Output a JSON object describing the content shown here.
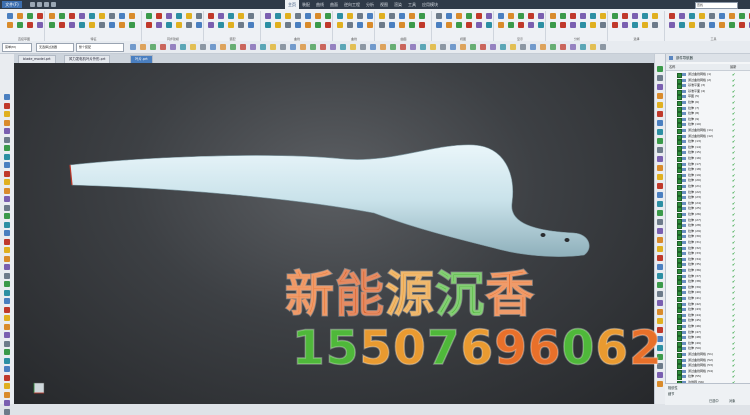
{
  "app": {
    "logo": "文件(F)"
  },
  "menu_tabs": [
    "主页",
    "装配",
    "曲线",
    "曲面",
    "逆向工程",
    "分析",
    "视图",
    "渲染",
    "工具",
    "应用模块"
  ],
  "search": {
    "value": "查找"
  },
  "ribbon_groups": [
    "直接草图",
    "特征",
    "同步建模",
    "装配",
    "曲线",
    "曲线",
    "曲面",
    "视图",
    "显示",
    "分析",
    "选择",
    "工具"
  ],
  "toolbar2": {
    "menu_label": "菜单(M)",
    "selection_filter": "无选择过滤器",
    "scope": "整个装配"
  },
  "doc_tabs": [
    {
      "label": "blade_model.prt",
      "active": false
    },
    {
      "label": "风力发电机叶片外形.prt",
      "active": false
    },
    {
      "label": "叶片.prt",
      "active": true
    }
  ],
  "navigator": {
    "title": "部件导航器",
    "col_name": "名称",
    "col_status": "最新",
    "rows": [
      "通过曲线网格 (1)",
      "通过曲线网格 (2)",
      "基准平面 (3)",
      "基准平面 (4)",
      "草图 (5)",
      "拉伸 (6)",
      "拉伸 (7)",
      "拉伸 (8)",
      "拉伸 (9)",
      "拉伸 (10)",
      "通过曲线网格 (11)",
      "通过曲线网格 (12)",
      "拉伸 (13)",
      "拉伸 (14)",
      "拉伸 (15)",
      "拉伸 (16)",
      "拉伸 (17)",
      "拉伸 (18)",
      "拉伸 (19)",
      "拉伸 (20)",
      "拉伸 (21)",
      "拉伸 (22)",
      "拉伸 (23)",
      "拉伸 (24)",
      "拉伸 (25)",
      "拉伸 (26)",
      "拉伸 (27)",
      "拉伸 (28)",
      "拉伸 (29)",
      "拉伸 (30)",
      "拉伸 (31)",
      "拉伸 (32)",
      "拉伸 (33)",
      "拉伸 (34)",
      "拉伸 (35)",
      "拉伸 (36)",
      "拉伸 (37)",
      "拉伸 (38)",
      "拉伸 (39)",
      "拉伸 (40)",
      "拉伸 (41)",
      "拉伸 (42)",
      "拉伸 (43)",
      "拉伸 (44)",
      "拉伸 (45)",
      "拉伸 (46)",
      "拉伸 (47)",
      "拉伸 (48)",
      "拉伸 (49)",
      "拉伸 (50)",
      "通过曲线网格 (51)",
      "通过曲线网格 (52)",
      "通过曲线网格 (53)",
      "通过曲线网格 (54)",
      "拉伸 (55)",
      "边倒圆 (56)"
    ]
  },
  "bottom_panel": {
    "title": "相依性",
    "subtitle": "细节",
    "status_left": "已选中",
    "status_right": "对象"
  },
  "watermark": {
    "line1": [
      "新",
      "能",
      "源",
      "沉",
      "香"
    ],
    "line2": [
      "1",
      "5",
      "5",
      "0",
      "7",
      "6",
      "9",
      "6",
      "0",
      "6",
      "2"
    ]
  },
  "colors": {
    "accent": "#4a7fc0",
    "blade": "#c9e2ea",
    "check": "#1a9a2a"
  }
}
